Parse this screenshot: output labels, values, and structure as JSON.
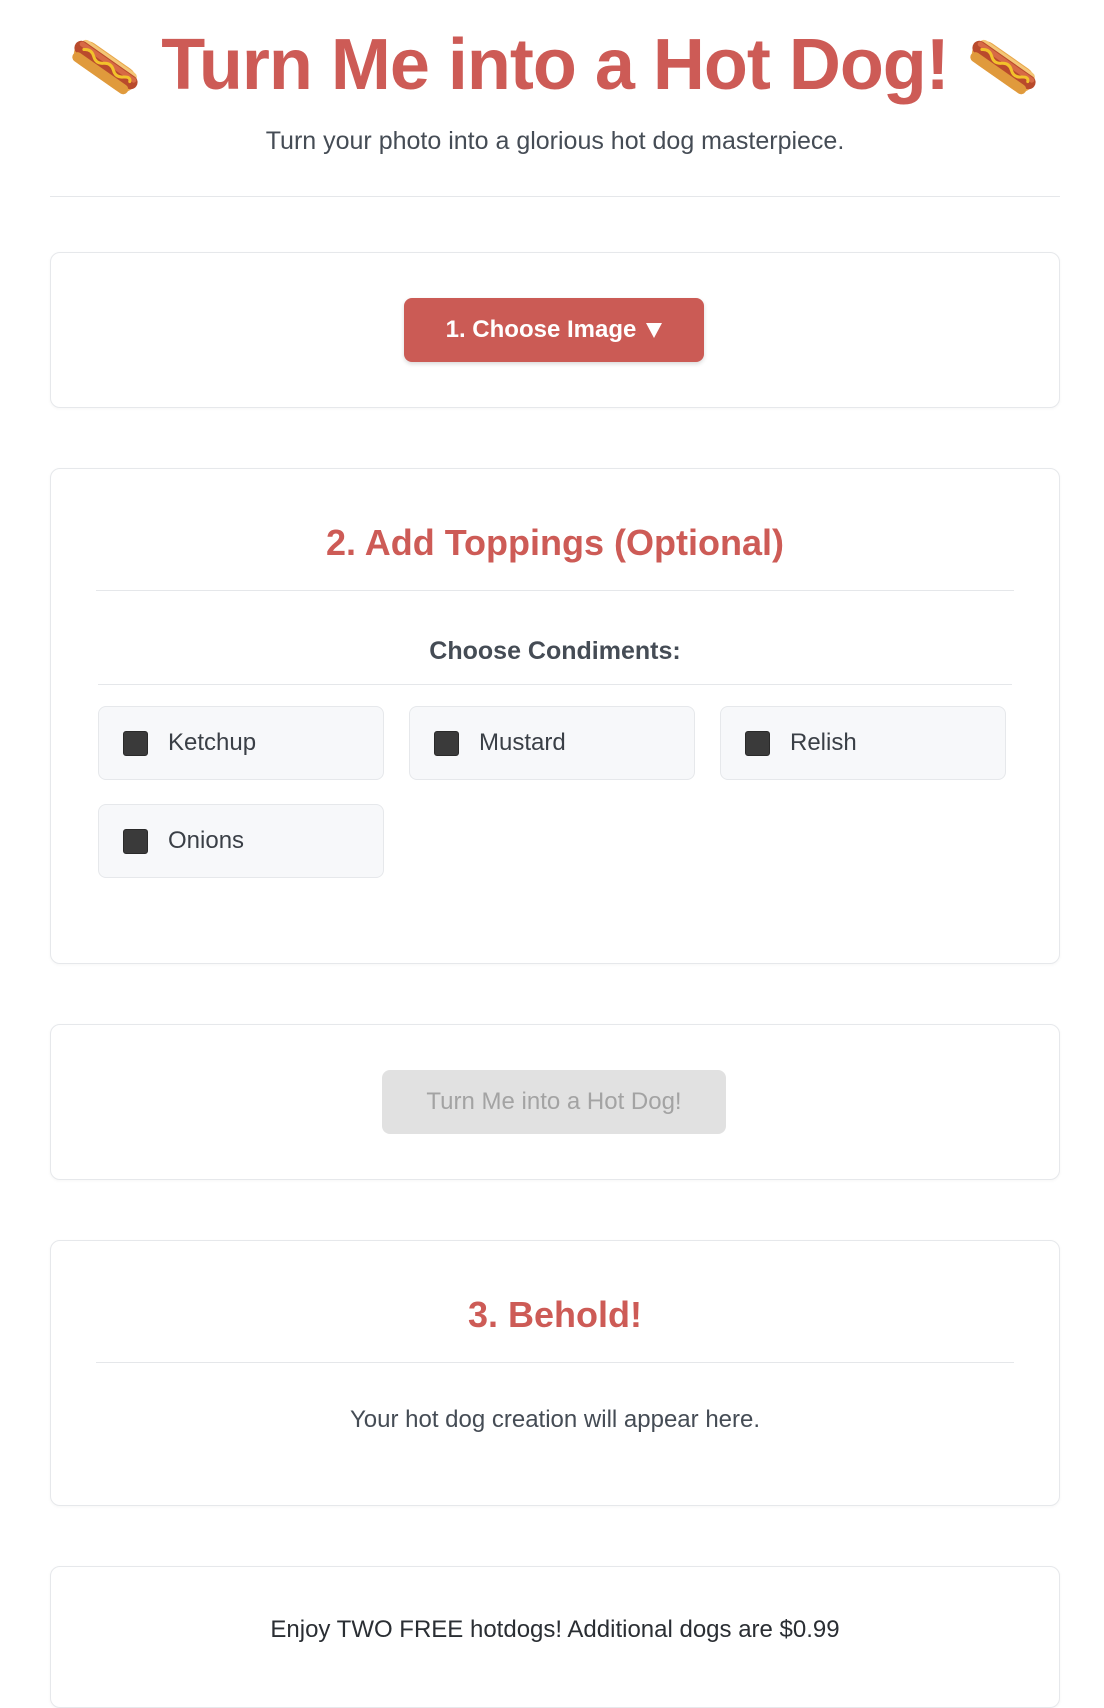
{
  "header": {
    "title": "Turn Me into a Hot Dog!",
    "title_icon": "hotdog-icon",
    "subtitle": "Turn your photo into a glorious hot dog masterpiece."
  },
  "upload": {
    "choose_image_label": "1. Choose Image",
    "choose_image_caret_icon": "caret-down-icon"
  },
  "toppings": {
    "title": "2. Add Toppings (Optional)",
    "condiments_heading": "Choose Condiments:",
    "condiments": [
      {
        "label": "Ketchup",
        "checked": false
      },
      {
        "label": "Mustard",
        "checked": false
      },
      {
        "label": "Relish",
        "checked": false
      },
      {
        "label": "Onions",
        "checked": false
      }
    ]
  },
  "generate": {
    "button_label": "Turn Me into a Hot Dog!",
    "disabled": true
  },
  "result": {
    "title": "3. Behold!",
    "placeholder": "Your hot dog creation will appear here."
  },
  "pricing": {
    "text": "Enjoy TWO FREE hotdogs! Additional dogs are $0.99"
  },
  "colors": {
    "accent": "#cd5b56",
    "button_primary": "#cb5b55",
    "button_disabled": "#e1e1e1",
    "text": "#454c55"
  }
}
